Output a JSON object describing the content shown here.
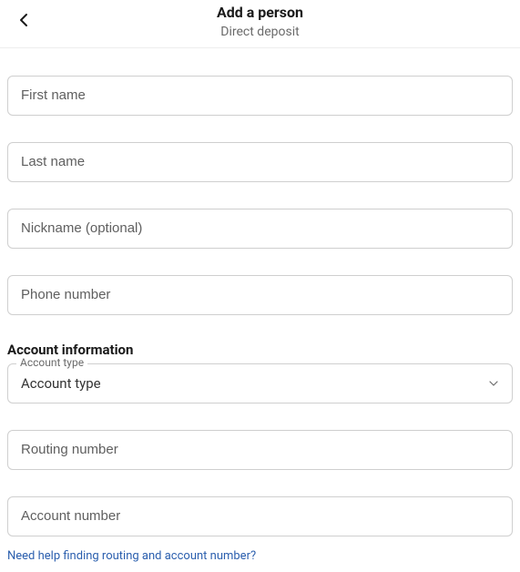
{
  "header": {
    "title": "Add a person",
    "subtitle": "Direct deposit"
  },
  "form": {
    "first_name_placeholder": "First name",
    "last_name_placeholder": "Last name",
    "nickname_placeholder": "Nickname (optional)",
    "phone_placeholder": "Phone number",
    "routing_placeholder": "Routing number",
    "account_number_placeholder": "Account number"
  },
  "account": {
    "section_title": "Account information",
    "type_label": "Account type",
    "type_value": "Account type"
  },
  "help": {
    "link_text": "Need help finding routing and account number?"
  }
}
